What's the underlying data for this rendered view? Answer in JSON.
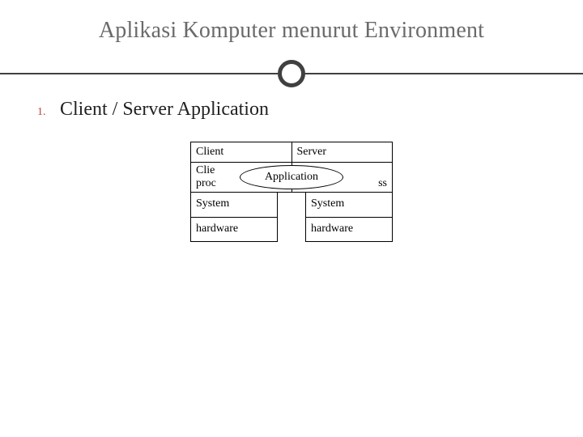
{
  "title": "Aplikasi Komputer menurut Environment",
  "list": {
    "num": "1.",
    "text": "Client / Server Application"
  },
  "diagram": {
    "header_left": "Client",
    "header_right": "Server",
    "row2_left_line1": "Clie",
    "row2_left_line2": "proc",
    "row2_right_suffix": "ss",
    "bubble": "Application",
    "col_left_1": "System",
    "col_left_2": "hardware",
    "col_right_1": "System",
    "col_right_2": "hardware"
  }
}
